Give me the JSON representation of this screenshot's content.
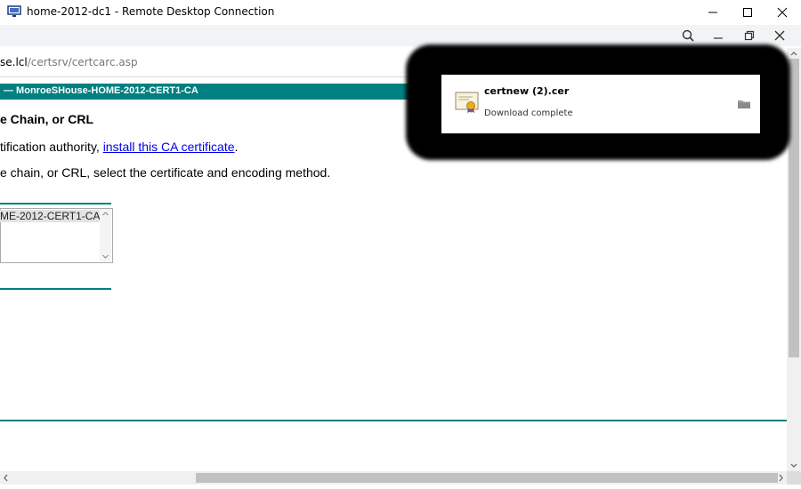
{
  "window": {
    "title": "home-2012-dc1 - Remote Desktop Connection",
    "minimize_glyph": "—",
    "maximize_glyph": "☐",
    "close_glyph": "✕"
  },
  "browser": {
    "url_host": "se.lcl",
    "url_path": "/certsrv/certcarc.asp",
    "toolbar_icons": [
      "search-icon",
      "minimize-icon",
      "restore-icon",
      "close-icon"
    ]
  },
  "page": {
    "header": "— MonroeSHouse-HOME-2012-CERT1-CA",
    "section_title": "e Chain, or CRL",
    "line1_prefix": "tification authority, ",
    "line1_link": "install this CA certificate",
    "line1_suffix": ".",
    "line2": "e chain, or CRL, select the certificate and encoding method.",
    "list_item": "ME-2012-CERT1-CA]"
  },
  "download": {
    "file_name": "certnew (2).cer",
    "status": "Download complete"
  },
  "colors": {
    "teal": "#008080",
    "link": "#0000ee"
  }
}
